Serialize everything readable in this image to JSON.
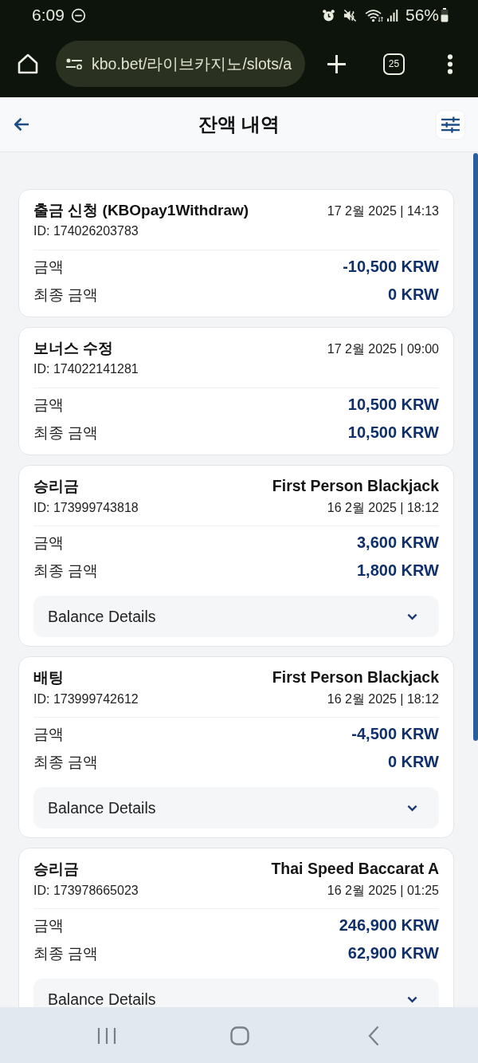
{
  "status_bar": {
    "time": "6:09",
    "battery": "56%"
  },
  "browser": {
    "url": "kbo.bet/라이브카지노/slots/a",
    "tab_count": "25"
  },
  "header": {
    "title": "잔액 내역"
  },
  "transactions": [
    {
      "title": "출금 신청 (KBOpay1Withdraw)",
      "id": "ID: 174026203783",
      "datetime": "17 2월 2025 | 14:13",
      "rows": [
        {
          "label": "금액",
          "value": "-10,500 KRW"
        },
        {
          "label": "최종 금액",
          "value": "0 KRW"
        }
      ]
    },
    {
      "title": "보너스 수정",
      "id": "ID: 174022141281",
      "datetime": "17 2월 2025 | 09:00",
      "rows": [
        {
          "label": "금액",
          "value": "10,500 KRW"
        },
        {
          "label": "최종 금액",
          "value": "10,500 KRW"
        }
      ]
    },
    {
      "title": "승리금",
      "game": "First Person Blackjack",
      "id": "ID: 173999743818",
      "datetime": "16 2월 2025 | 18:12",
      "rows": [
        {
          "label": "금액",
          "value": "3,600 KRW"
        },
        {
          "label": "최종 금액",
          "value": "1,800 KRW"
        }
      ],
      "details": {
        "label": "Balance Details",
        "expanded": false
      }
    },
    {
      "title": "배팅",
      "game": "First Person Blackjack",
      "id": "ID: 173999742612",
      "datetime": "16 2월 2025 | 18:12",
      "rows": [
        {
          "label": "금액",
          "value": "-4,500 KRW"
        },
        {
          "label": "최종 금액",
          "value": "0 KRW"
        }
      ],
      "details": {
        "label": "Balance Details",
        "expanded": false
      }
    },
    {
      "title": "승리금",
      "game": "Thai Speed Baccarat A",
      "id": "ID: 173978665023",
      "datetime": "16 2월 2025 | 01:25",
      "rows": [
        {
          "label": "금액",
          "value": "246,900 KRW"
        },
        {
          "label": "최종 금액",
          "value": "62,900 KRW"
        }
      ],
      "details": {
        "label": "Balance Details",
        "expanded": false
      }
    }
  ]
}
